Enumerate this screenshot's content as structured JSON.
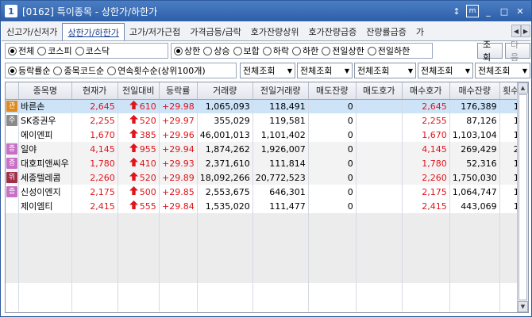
{
  "window": {
    "number": "1",
    "title": "[0162]  특이종목 - 상한가/하한가"
  },
  "tabs": [
    "신고가/신저가",
    "상한가/하한가",
    "고가/저가근접",
    "가격급등/급락",
    "호가잔량상위",
    "호가잔량급증",
    "잔량률급증",
    "가"
  ],
  "active_tab": 1,
  "market_radios": [
    {
      "label": "전체",
      "checked": true
    },
    {
      "label": "코스피",
      "checked": false
    },
    {
      "label": "코스닥",
      "checked": false
    }
  ],
  "limit_radios": [
    {
      "label": "상한",
      "checked": true
    },
    {
      "label": "상승",
      "checked": false
    },
    {
      "label": "보합",
      "checked": false
    },
    {
      "label": "하락",
      "checked": false
    },
    {
      "label": "하한",
      "checked": false
    },
    {
      "label": "전일상한",
      "checked": false
    },
    {
      "label": "전일하한",
      "checked": false
    }
  ],
  "buttons": {
    "query": "조회",
    "next": "다음"
  },
  "sort_radios": [
    {
      "label": "등락률순",
      "checked": true
    },
    {
      "label": "종목코드순",
      "checked": false
    },
    {
      "label": "연속횟수순(상위100개)",
      "checked": false
    }
  ],
  "filters": [
    "전체조회",
    "전체조회",
    "전체조회",
    "전체조회",
    "전체조회"
  ],
  "columns": [
    "종목명",
    "현재가",
    "전일대비",
    "등락률",
    "거래량",
    "전일거래량",
    "매도잔량",
    "매도호가",
    "매수호가",
    "매수잔량",
    "횟수"
  ],
  "rows": [
    {
      "badge": "관",
      "badge_color": "#e08a1e",
      "name": "바른손",
      "price": "2,645",
      "change": "610",
      "rate": "+29.98",
      "volume": "1,065,093",
      "prev_volume": "118,491",
      "ask_qty": "0",
      "ask": "",
      "bid": "2,645",
      "bid_qty": "176,389",
      "count": "1"
    },
    {
      "badge": "주",
      "badge_color": "#8a8a8a",
      "name": "SK증권우",
      "price": "2,255",
      "change": "520",
      "rate": "+29.97",
      "volume": "355,029",
      "prev_volume": "119,581",
      "ask_qty": "0",
      "ask": "",
      "bid": "2,255",
      "bid_qty": "87,126",
      "count": "1"
    },
    {
      "badge": "",
      "badge_color": "",
      "name": "에이엔피",
      "price": "1,670",
      "change": "385",
      "rate": "+29.96",
      "volume": "46,001,013",
      "prev_volume": "1,101,402",
      "ask_qty": "0",
      "ask": "",
      "bid": "1,670",
      "bid_qty": "1,103,104",
      "count": "1"
    },
    {
      "badge": "증",
      "badge_color": "#c76fc4",
      "name": "일야",
      "price": "4,145",
      "change": "955",
      "rate": "+29.94",
      "volume": "1,874,262",
      "prev_volume": "1,926,007",
      "ask_qty": "0",
      "ask": "",
      "bid": "4,145",
      "bid_qty": "269,429",
      "count": "2"
    },
    {
      "badge": "증",
      "badge_color": "#c76fc4",
      "name": "대호피앤씨우",
      "price": "1,780",
      "change": "410",
      "rate": "+29.93",
      "volume": "2,371,610",
      "prev_volume": "111,814",
      "ask_qty": "0",
      "ask": "",
      "bid": "1,780",
      "bid_qty": "52,316",
      "count": "1"
    },
    {
      "badge": "위",
      "badge_color": "#a0304a",
      "name": "세종텔레콤",
      "price": "2,260",
      "change": "520",
      "rate": "+29.89",
      "volume": "18,092,266",
      "prev_volume": "20,772,523",
      "ask_qty": "0",
      "ask": "",
      "bid": "2,260",
      "bid_qty": "1,750,030",
      "count": "1"
    },
    {
      "badge": "증",
      "badge_color": "#c76fc4",
      "name": "신성이엔지",
      "price": "2,175",
      "change": "500",
      "rate": "+29.85",
      "volume": "2,553,675",
      "prev_volume": "646,301",
      "ask_qty": "0",
      "ask": "",
      "bid": "2,175",
      "bid_qty": "1,064,747",
      "count": "1"
    },
    {
      "badge": "",
      "badge_color": "",
      "name": "제이엠티",
      "price": "2,415",
      "change": "555",
      "rate": "+29.84",
      "volume": "1,535,020",
      "prev_volume": "111,477",
      "ask_qty": "0",
      "ask": "",
      "bid": "2,415",
      "bid_qty": "443,069",
      "count": "1"
    }
  ],
  "colors": {
    "title_bar": "#2d5fa8",
    "up_red": "#e0141b",
    "selected_row": "#cde3f7"
  }
}
